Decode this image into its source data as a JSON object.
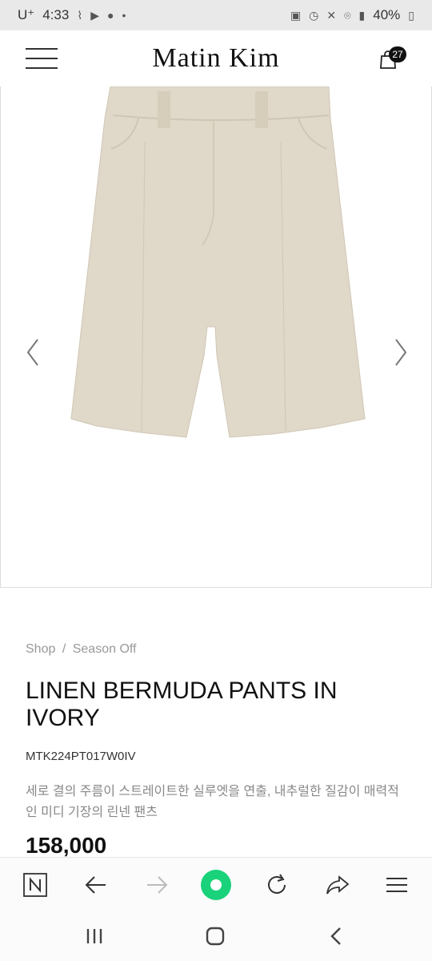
{
  "status_bar": {
    "carrier": "U⁺",
    "time": "4:33",
    "battery": "40%"
  },
  "header": {
    "brand": "Matin Kim",
    "cart_count": "27"
  },
  "product": {
    "breadcrumb_shop": "Shop",
    "breadcrumb_sep": "/",
    "breadcrumb_category": "Season Off",
    "title": "LINEN BERMUDA PANTS IN IVORY",
    "sku": "MTK224PT017W0IV",
    "description": "세로 결의 주름이 스트레이트한 실루엣을 연출, 내추럴한 질감이 매력적인 미디 기장의 린넨 팬츠",
    "price": "158,000"
  },
  "colors": {
    "fabric": "#e0d8c9",
    "fabric_shadow": "#cfc6b4",
    "accent_green": "#19d27a"
  }
}
